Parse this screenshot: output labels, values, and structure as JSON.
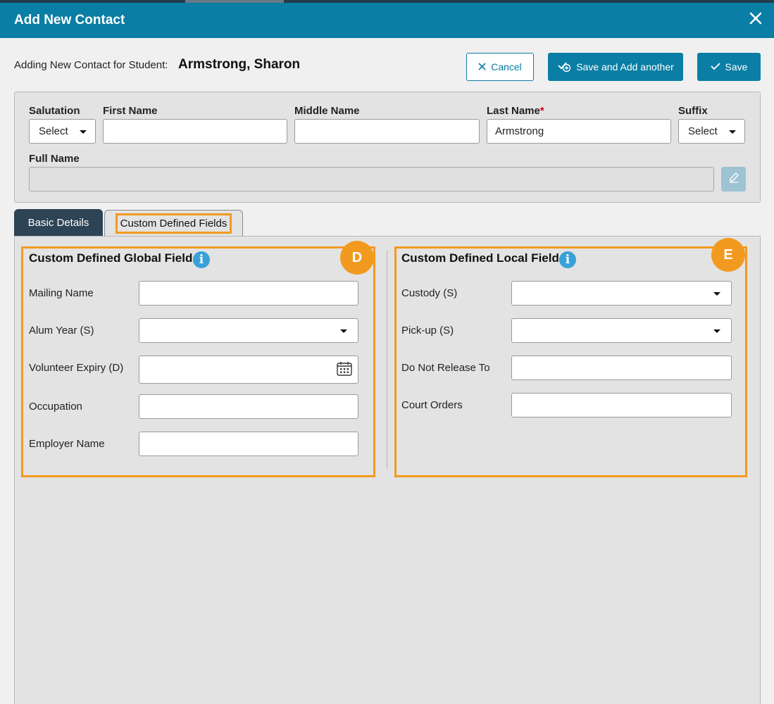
{
  "dialog": {
    "title": "Add New Contact"
  },
  "header": {
    "subheading": "Adding New Contact for Student:",
    "student_name": "Armstrong, Sharon",
    "cancel_label": "Cancel",
    "save_add_another_label": "Save and Add another",
    "save_label": "Save"
  },
  "name_panel": {
    "salutation_label": "Salutation",
    "salutation_value": "Select",
    "first_name_label": "First Name",
    "first_name_value": "",
    "middle_name_label": "Middle Name",
    "middle_name_value": "",
    "last_name_label": "Last Name",
    "last_name_required_marker": "*",
    "last_name_value": "Armstrong",
    "suffix_label": "Suffix",
    "suffix_value": "Select",
    "full_name_label": "Full Name",
    "full_name_value": ""
  },
  "tabs": [
    {
      "label": "Basic Details",
      "active": false
    },
    {
      "label": "Custom Defined Fields",
      "active": true
    }
  ],
  "global_fields": {
    "title": "Custom Defined Global Fields",
    "badge": "D",
    "fields": [
      {
        "label": "Mailing Name",
        "type": "text",
        "value": ""
      },
      {
        "label": "Alum Year (S)",
        "type": "select",
        "value": ""
      },
      {
        "label": "Volunteer Expiry (D)",
        "type": "date",
        "value": ""
      },
      {
        "label": "Occupation",
        "type": "text",
        "value": ""
      },
      {
        "label": "Employer Name",
        "type": "text",
        "value": ""
      }
    ]
  },
  "local_fields": {
    "title": "Custom Defined Local Fields",
    "badge": "E",
    "fields": [
      {
        "label": "Custody (S)",
        "type": "select",
        "value": ""
      },
      {
        "label": "Pick-up (S)",
        "type": "select",
        "value": ""
      },
      {
        "label": "Do Not Release To",
        "type": "text",
        "value": ""
      },
      {
        "label": "Court Orders",
        "type": "text",
        "value": ""
      }
    ]
  },
  "colors": {
    "titlebar": "#0a7ea4",
    "primary_button": "#0a7ea4",
    "active_tab": "#2d4456",
    "highlight": "#f29a1f",
    "info_icon": "#3aa1d8",
    "required": "#d0021b"
  },
  "icons": {
    "close": "close-icon",
    "cancel": "x-icon",
    "save_add_another": "check-plus-icon",
    "save": "check-icon",
    "dropdown": "caret-down-icon",
    "edit": "pencil-icon",
    "info": "info-icon",
    "date": "calendar-icon"
  }
}
